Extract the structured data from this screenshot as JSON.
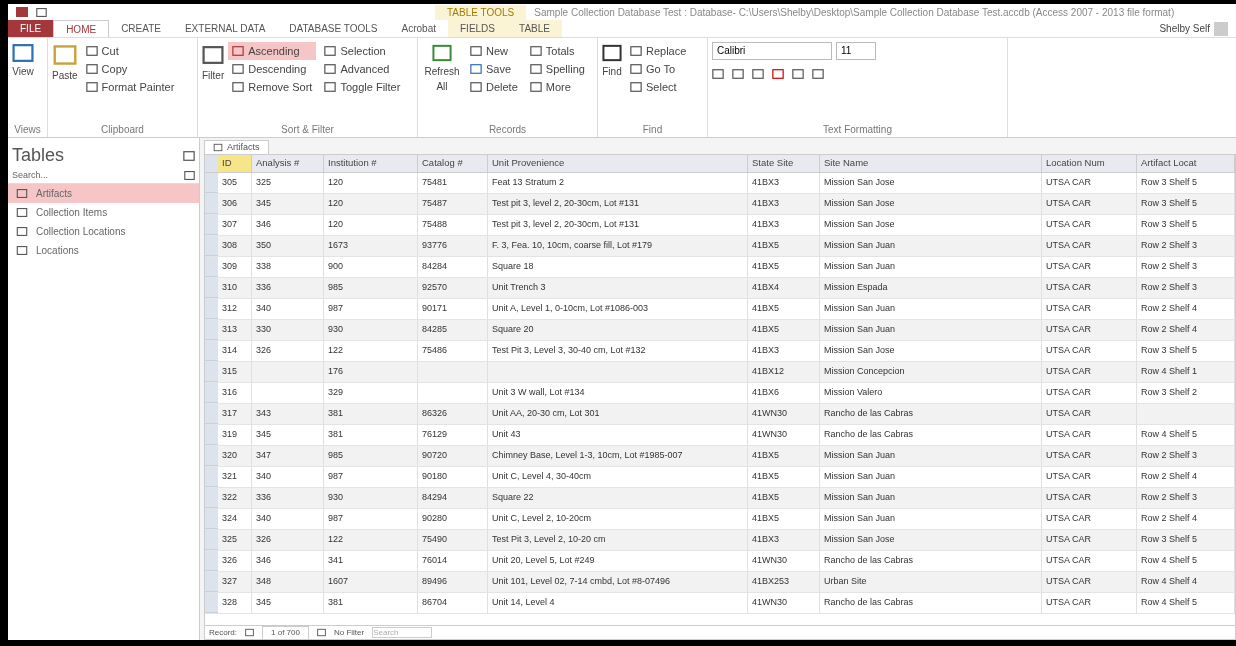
{
  "window": {
    "title": "Sample Collection Database Test : Database- C:\\Users\\Shelby\\Desktop\\Sample Collection Database Test.accdb (Access 2007 - 2013 file format)",
    "context_tab_group": "TABLE TOOLS",
    "user": "Shelby Self"
  },
  "ribbon_tabs": [
    {
      "label": "FILE",
      "kind": "file",
      "selected": false
    },
    {
      "label": "HOME",
      "kind": "normal",
      "selected": true
    },
    {
      "label": "CREATE",
      "kind": "normal",
      "selected": false
    },
    {
      "label": "EXTERNAL DATA",
      "kind": "normal",
      "selected": false
    },
    {
      "label": "DATABASE TOOLS",
      "kind": "normal",
      "selected": false
    },
    {
      "label": "Acrobat",
      "kind": "normal",
      "selected": false
    },
    {
      "label": "FIELDS",
      "kind": "context",
      "selected": false
    },
    {
      "label": "TABLE",
      "kind": "context",
      "selected": false
    }
  ],
  "ribbon_groups": {
    "views": {
      "label": "Views",
      "view": "View"
    },
    "clipboard": {
      "label": "Clipboard",
      "paste": "Paste",
      "cut": "Cut",
      "copy": "Copy",
      "format_painter": "Format Painter"
    },
    "sort_filter": {
      "label": "Sort & Filter",
      "filter": "Filter",
      "ascending": "Ascending",
      "descending": "Descending",
      "remove_sort": "Remove Sort",
      "selection": "Selection",
      "advanced": "Advanced",
      "toggle_filter": "Toggle Filter"
    },
    "records": {
      "label": "Records",
      "refresh": "Refresh All",
      "new": "New",
      "save": "Save",
      "delete": "Delete",
      "totals": "Totals",
      "spelling": "Spelling",
      "more": "More"
    },
    "find": {
      "label": "Find",
      "find": "Find",
      "replace": "Replace",
      "goto": "Go To",
      "select": "Select"
    },
    "text_formatting": {
      "label": "Text Formatting",
      "font": "Calibri",
      "size": "11"
    }
  },
  "nav_pane": {
    "title": "Tables",
    "search_placeholder": "Search...",
    "items": [
      {
        "label": "Artifacts",
        "selected": true
      },
      {
        "label": "Collection Items",
        "selected": false
      },
      {
        "label": "Collection Locations",
        "selected": false
      },
      {
        "label": "Locations",
        "selected": false
      }
    ]
  },
  "document_tab": "Artifacts",
  "table": {
    "columns": [
      "ID",
      "Analysis #",
      "Institution #",
      "Catalog #",
      "Unit Provenience",
      "State Site",
      "Site Name",
      "Location Num",
      "Artifact Locat"
    ],
    "rows": [
      [
        "305",
        "325",
        "120",
        "75481",
        "Feat 13 Stratum 2",
        "41BX3",
        "Mission San Jose",
        "UTSA CAR",
        "Row 3 Shelf 5"
      ],
      [
        "306",
        "345",
        "120",
        "75487",
        "Test pit 3, level 2, 20-30cm, Lot #131",
        "41BX3",
        "Mission San Jose",
        "UTSA CAR",
        "Row 3 Shelf 5"
      ],
      [
        "307",
        "346",
        "120",
        "75488",
        "Test pit 3, level 2, 20-30cm, Lot #131",
        "41BX3",
        "Mission San Jose",
        "UTSA CAR",
        "Row 3 Shelf 5"
      ],
      [
        "308",
        "350",
        "1673",
        "93776",
        "F. 3, Fea. 10, 10cm, coarse fill, Lot #179",
        "41BX5",
        "Mission San Juan",
        "UTSA CAR",
        "Row 2 Shelf 3"
      ],
      [
        "309",
        "338",
        "900",
        "84284",
        "Square 18",
        "41BX5",
        "Mission San Juan",
        "UTSA CAR",
        "Row 2 Shelf 3"
      ],
      [
        "310",
        "336",
        "985",
        "92570",
        "Unit Trench 3",
        "41BX4",
        "Mission Espada",
        "UTSA CAR",
        "Row 2 Shelf 3"
      ],
      [
        "312",
        "340",
        "987",
        "90171",
        "Unit A, Level 1, 0-10cm, Lot #1086-003",
        "41BX5",
        "Mission San Juan",
        "UTSA CAR",
        "Row 2 Shelf 4"
      ],
      [
        "313",
        "330",
        "930",
        "84285",
        "Square 20",
        "41BX5",
        "Mission San Juan",
        "UTSA CAR",
        "Row 2 Shelf 4"
      ],
      [
        "314",
        "326",
        "122",
        "75486",
        "Test Pit 3, Level 3, 30-40 cm, Lot #132",
        "41BX3",
        "Mission San Jose",
        "UTSA CAR",
        "Row 3 Shelf 5"
      ],
      [
        "315",
        "",
        "176",
        "",
        "",
        "41BX12",
        "Mission Concepcion",
        "UTSA CAR",
        "Row 4 Shelf 1"
      ],
      [
        "316",
        "",
        "329",
        "",
        "Unit 3 W wall, Lot #134",
        "41BX6",
        "Mission Valero",
        "UTSA CAR",
        "Row 3 Shelf 2"
      ],
      [
        "317",
        "343",
        "381",
        "86326",
        "Unit AA, 20-30 cm, Lot 301",
        "41WN30",
        "Rancho de las Cabras",
        "UTSA CAR",
        ""
      ],
      [
        "319",
        "345",
        "381",
        "76129",
        "Unit 43",
        "41WN30",
        "Rancho de las Cabras",
        "UTSA CAR",
        "Row 4 Shelf 5"
      ],
      [
        "320",
        "347",
        "985",
        "90720",
        "Chimney Base, Level 1-3, 10cm, Lot #1985-007",
        "41BX5",
        "Mission San Juan",
        "UTSA CAR",
        "Row 2 Shelf 3"
      ],
      [
        "321",
        "340",
        "987",
        "90180",
        "Unit C, Level 4, 30-40cm",
        "41BX5",
        "Mission San Juan",
        "UTSA CAR",
        "Row 2 Shelf 4"
      ],
      [
        "322",
        "336",
        "930",
        "84294",
        "Square 22",
        "41BX5",
        "Mission San Juan",
        "UTSA CAR",
        "Row 2 Shelf 3"
      ],
      [
        "324",
        "340",
        "987",
        "90280",
        "Unit C, Level 2, 10-20cm",
        "41BX5",
        "Mission San Juan",
        "UTSA CAR",
        "Row 2 Shelf 4"
      ],
      [
        "325",
        "326",
        "122",
        "75490",
        "Test Pit 3, Level 2, 10-20 cm",
        "41BX3",
        "Mission San Jose",
        "UTSA CAR",
        "Row 3 Shelf 5"
      ],
      [
        "326",
        "346",
        "341",
        "76014",
        "Unit 20, Level 5, Lot #249",
        "41WN30",
        "Rancho de las Cabras",
        "UTSA CAR",
        "Row 4 Shelf 5"
      ],
      [
        "327",
        "348",
        "1607",
        "89496",
        "Unit 101, Level 02, 7-14 cmbd, Lot #8-07496",
        "41BX253",
        "Urban Site",
        "UTSA CAR",
        "Row 4 Shelf 4"
      ],
      [
        "328",
        "345",
        "381",
        "86704",
        "Unit 14, Level 4",
        "41WN30",
        "Rancho de las Cabras",
        "UTSA CAR",
        "Row 4 Shelf 5"
      ]
    ]
  },
  "record_nav": {
    "label": "Record:",
    "position": "1 of 700",
    "filter": "No Filter",
    "search_placeholder": "Search"
  }
}
